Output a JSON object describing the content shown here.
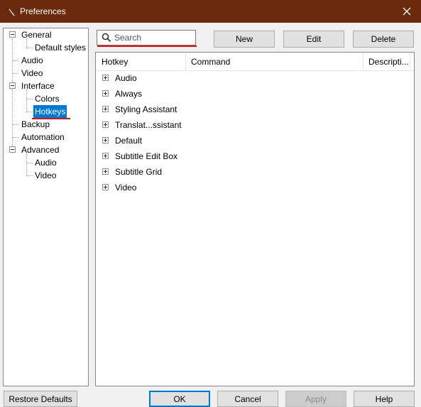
{
  "window": {
    "title": "Preferences",
    "close_symbol": "✕",
    "icon": "app-icon"
  },
  "tree": {
    "general": "General",
    "default_styles": "Default styles",
    "audio": "Audio",
    "video": "Video",
    "interface": "Interface",
    "colors": "Colors",
    "hotkeys": "Hotkeys",
    "backup": "Backup",
    "automation": "Automation",
    "advanced": "Advanced",
    "advanced_audio": "Audio",
    "advanced_video": "Video",
    "selected": "Hotkeys"
  },
  "search": {
    "placeholder": "Search"
  },
  "toolbar": {
    "new_label": "New",
    "edit_label": "Edit",
    "delete_label": "Delete"
  },
  "list": {
    "columns": [
      "Hotkey",
      "Command",
      "Descripti..."
    ],
    "rows": [
      "Audio",
      "Always",
      "Styling Assistant",
      "Translat...ssistant",
      "Default",
      "Subtitle Edit Box",
      "Subtitle Grid",
      "Video"
    ]
  },
  "footer": {
    "restore_label": "Restore Defaults",
    "ok_label": "OK",
    "cancel_label": "Cancel",
    "apply_label": "Apply",
    "help_label": "Help"
  },
  "colors": {
    "titlebar": "#6b2a0b",
    "selection": "#0078d7",
    "annotation_underline": "#e01010"
  }
}
